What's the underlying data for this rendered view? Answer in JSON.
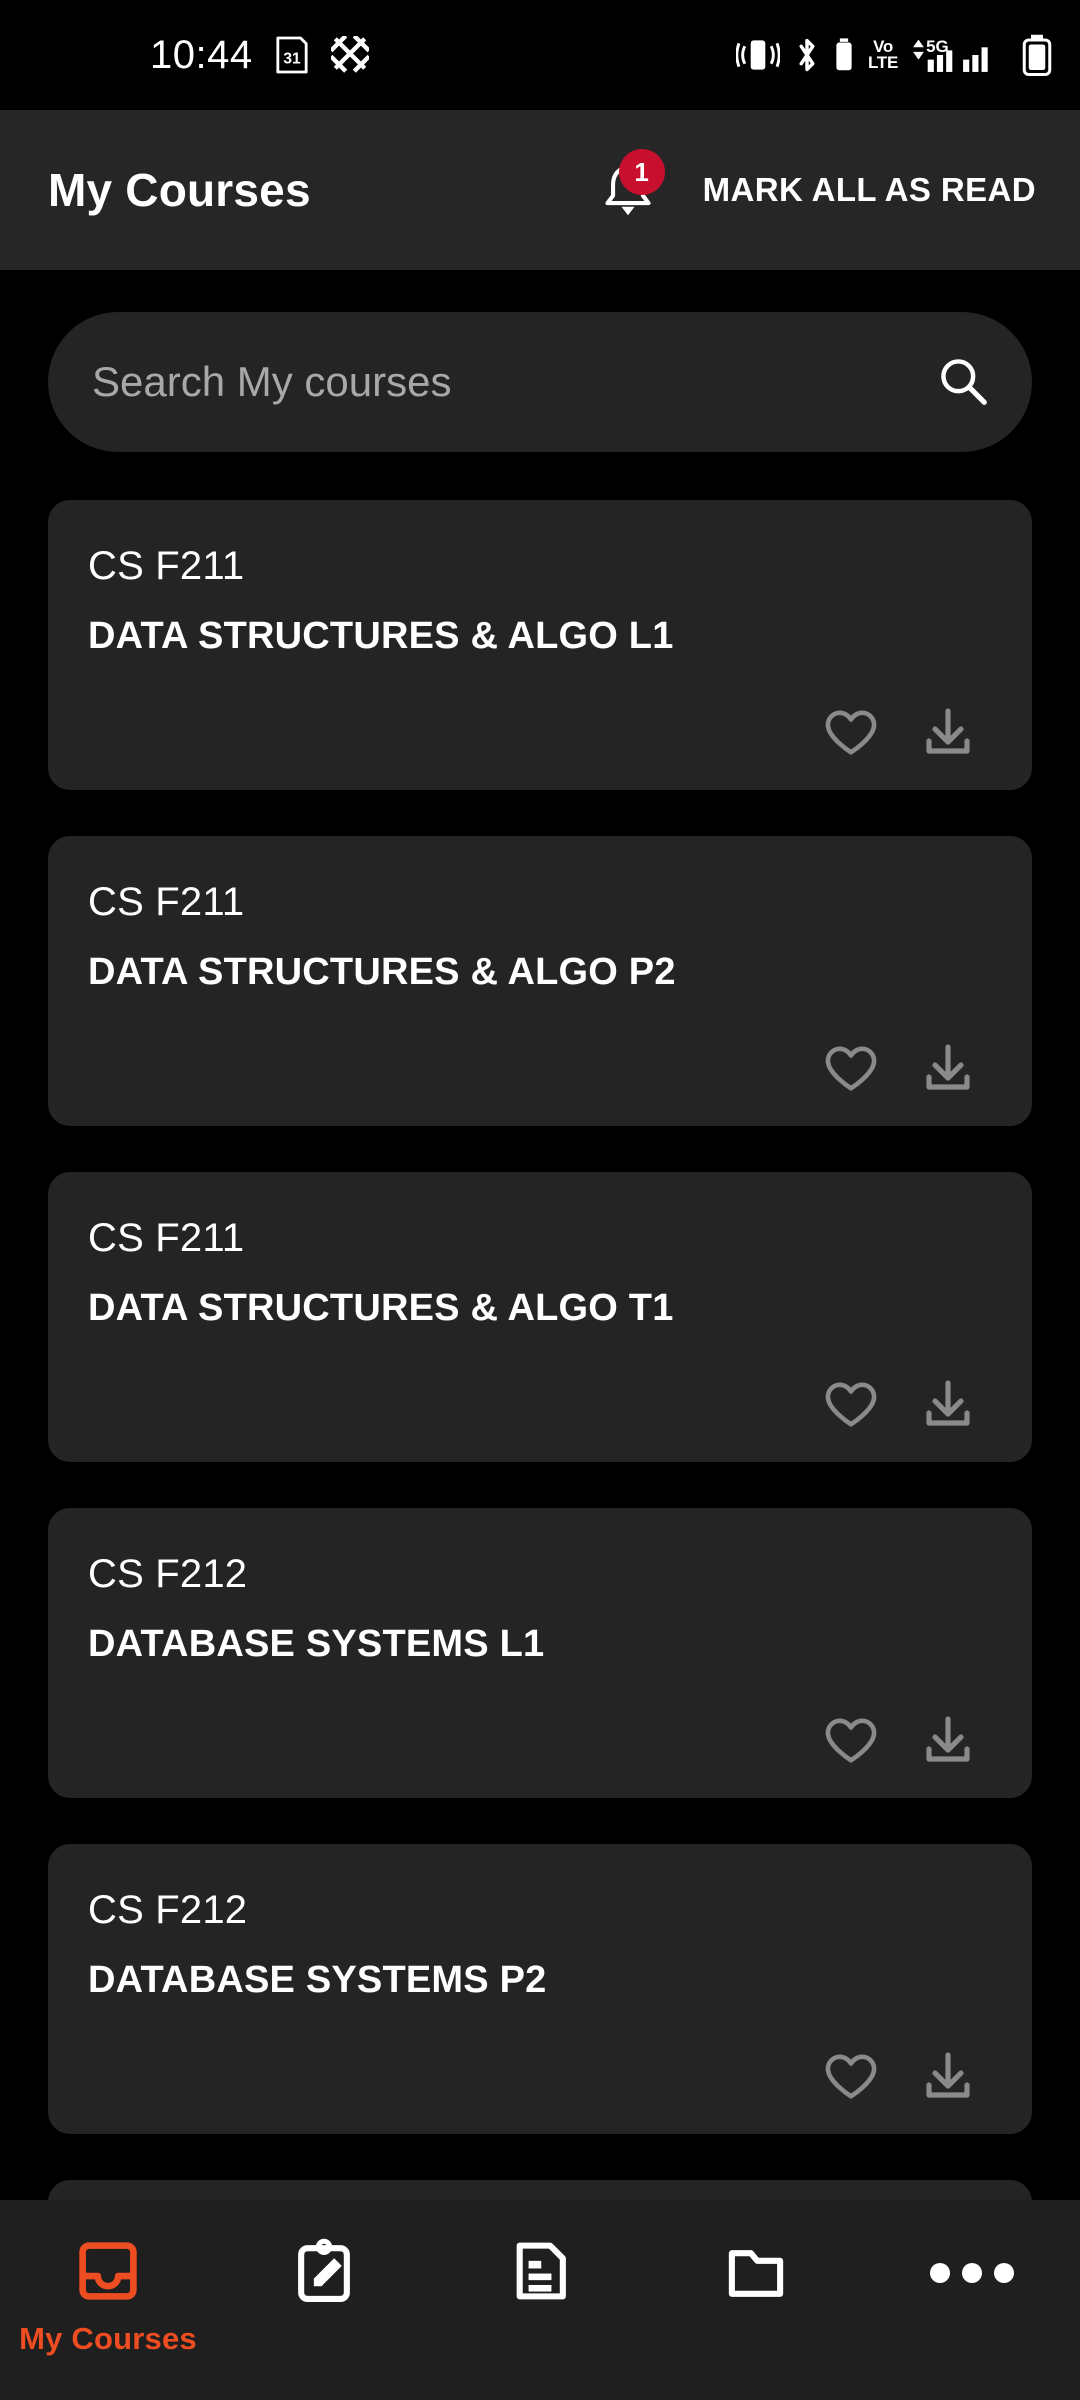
{
  "status_bar": {
    "time": "10:44",
    "left_icons": [
      "calendar-31-icon",
      "app-x-icon"
    ],
    "right_icons": [
      "vibrate-icon",
      "bluetooth-icon",
      "bluetooth-battery-icon",
      "volte-icon",
      "5g-signal-icon",
      "battery-icon"
    ],
    "volte_top": "Vo",
    "volte_bottom": "LTE",
    "network_label": "5G",
    "calendar_day": "31"
  },
  "app_bar": {
    "title": "My Courses",
    "notification_icon": "bell-icon",
    "notification_count": "1",
    "mark_all_read_label": "MARK ALL AS READ"
  },
  "search": {
    "placeholder": "Search My courses",
    "icon": "search-icon",
    "value": ""
  },
  "courses": [
    {
      "code": "CS F211",
      "name": "DATA STRUCTURES & ALGO L1",
      "favorite_icon": "heart-outline-icon",
      "download_icon": "download-icon",
      "favorited": false
    },
    {
      "code": "CS F211",
      "name": "DATA STRUCTURES & ALGO P2",
      "favorite_icon": "heart-outline-icon",
      "download_icon": "download-icon",
      "favorited": false
    },
    {
      "code": "CS F211",
      "name": "DATA STRUCTURES & ALGO T1",
      "favorite_icon": "heart-outline-icon",
      "download_icon": "download-icon",
      "favorited": false
    },
    {
      "code": "CS F212",
      "name": "DATABASE SYSTEMS L1",
      "favorite_icon": "heart-outline-icon",
      "download_icon": "download-icon",
      "favorited": false
    },
    {
      "code": "CS F212",
      "name": "DATABASE SYSTEMS P2",
      "favorite_icon": "heart-outline-icon",
      "download_icon": "download-icon",
      "favorited": false
    }
  ],
  "bottom_nav": [
    {
      "label": "My Courses",
      "icon": "inbox-tray-icon",
      "active": true
    },
    {
      "label": "",
      "icon": "clipboard-pencil-icon",
      "active": false
    },
    {
      "label": "",
      "icon": "document-lines-icon",
      "active": false
    },
    {
      "label": "",
      "icon": "folder-icon",
      "active": false
    },
    {
      "label": "",
      "icon": "more-dots-icon",
      "active": false
    }
  ],
  "colors": {
    "background": "#000000",
    "app_bar": "#262626",
    "card": "#242424",
    "accent_orange": "#EE4D22",
    "badge_red": "#C8102E",
    "icon_gray": "#8A8A8A",
    "placeholder_gray": "#A8A8A8"
  }
}
